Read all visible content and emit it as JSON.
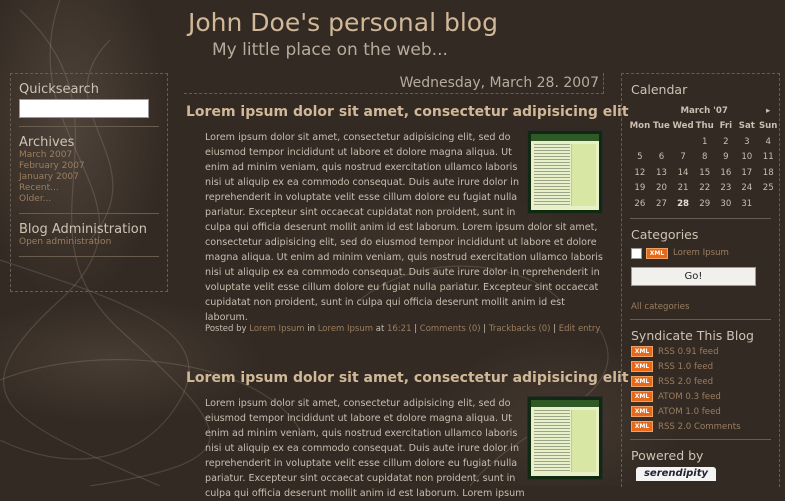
{
  "header": {
    "title": "John Doe's personal blog",
    "subtitle": "My little place on the web..."
  },
  "left_sidebar": {
    "quicksearch_title": "Quicksearch",
    "quicksearch_value": "",
    "archives_title": "Archives",
    "archive_links": [
      "March 2007",
      "February 2007",
      "January 2007",
      "Recent...",
      "Older..."
    ],
    "admin_title": "Blog Administration",
    "admin_link": "Open administration"
  },
  "date_header": "Wednesday, March 28. 2007",
  "entries": [
    {
      "title": "Lorem ipsum dolor sit amet, consectetur adipisicing elit",
      "body": "Lorem ipsum dolor sit amet, consectetur adipisicing elit, sed do eiusmod tempor incididunt ut labore et dolore magna aliqua. Ut enim ad minim veniam, quis nostrud exercitation ullamco laboris nisi ut aliquip ex ea commodo consequat. Duis aute irure dolor in reprehenderit in voluptate velit esse cillum dolore eu fugiat nulla pariatur. Excepteur sint occaecat cupidatat non proident, sunt in culpa qui officia deserunt mollit anim id est laborum. Lorem ipsum dolor sit amet, consectetur adipisicing elit, sed do eiusmod tempor incididunt ut labore et dolore magna aliqua. Ut enim ad minim veniam, quis nostrud exercitation ullamco laboris nisi ut aliquip ex ea commodo consequat. Duis aute irure dolor in reprehenderit in voluptate velit esse cillum dolore eu fugiat nulla pariatur. Excepteur sint occaecat cupidatat non proident, sunt in culpa qui officia deserunt mollit anim id est laborum.",
      "footer": {
        "posted_by": "Posted by",
        "author": "Lorem Ipsum",
        "in": "in",
        "category": "Lorem Ipsum",
        "at": "at",
        "time": "16:21",
        "comments": "Comments (0)",
        "trackbacks": "Trackbacks (0)",
        "edit": "Edit entry",
        "sep": "|"
      }
    },
    {
      "title": "Lorem ipsum dolor sit amet, consectetur adipisicing elit",
      "body": "Lorem ipsum dolor sit amet, consectetur adipisicing elit, sed do eiusmod tempor incididunt ut labore et dolore magna aliqua. Ut enim ad minim veniam, quis nostrud exercitation ullamco laboris nisi ut aliquip ex ea commodo consequat. Duis aute irure dolor in reprehenderit in voluptate velit esse cillum dolore eu fugiat nulla pariatur. Excepteur sint occaecat cupidatat non proident, sunt in culpa qui officia deserunt mollit anim id est laborum. Lorem ipsum"
    }
  ],
  "right_sidebar": {
    "calendar_title": "Calendar",
    "calendar_month": "March '07",
    "calendar_next": "▸",
    "weekdays": [
      "Mon",
      "Tue",
      "Wed",
      "Thu",
      "Fri",
      "Sat",
      "Sun"
    ],
    "weeks": [
      [
        "",
        "",
        "",
        "1",
        "2",
        "3",
        "4"
      ],
      [
        "5",
        "6",
        "7",
        "8",
        "9",
        "10",
        "11"
      ],
      [
        "12",
        "13",
        "14",
        "15",
        "16",
        "17",
        "18"
      ],
      [
        "19",
        "20",
        "21",
        "22",
        "23",
        "24",
        "25"
      ],
      [
        "26",
        "27",
        "28",
        "29",
        "30",
        "31",
        ""
      ]
    ],
    "calendar_bold_day": "28",
    "categories_title": "Categories",
    "category_item": "Lorem Ipsum",
    "xml_badge": "XML",
    "go_label": "Go!",
    "all_categories": "All categories",
    "syndicate_title": "Syndicate This Blog",
    "feeds": [
      "RSS 0.91 feed",
      "RSS 1.0 feed",
      "RSS 2.0 feed",
      "ATOM 0.3 feed",
      "ATOM 1.0 feed",
      "RSS 2.0 Comments"
    ],
    "powered_title": "Powered by",
    "powered_badge": "serendipity"
  },
  "colors": {
    "background": "#332a23",
    "title": "#d0b898",
    "link": "#9a7e60",
    "xml_badge": "#e8681a"
  }
}
